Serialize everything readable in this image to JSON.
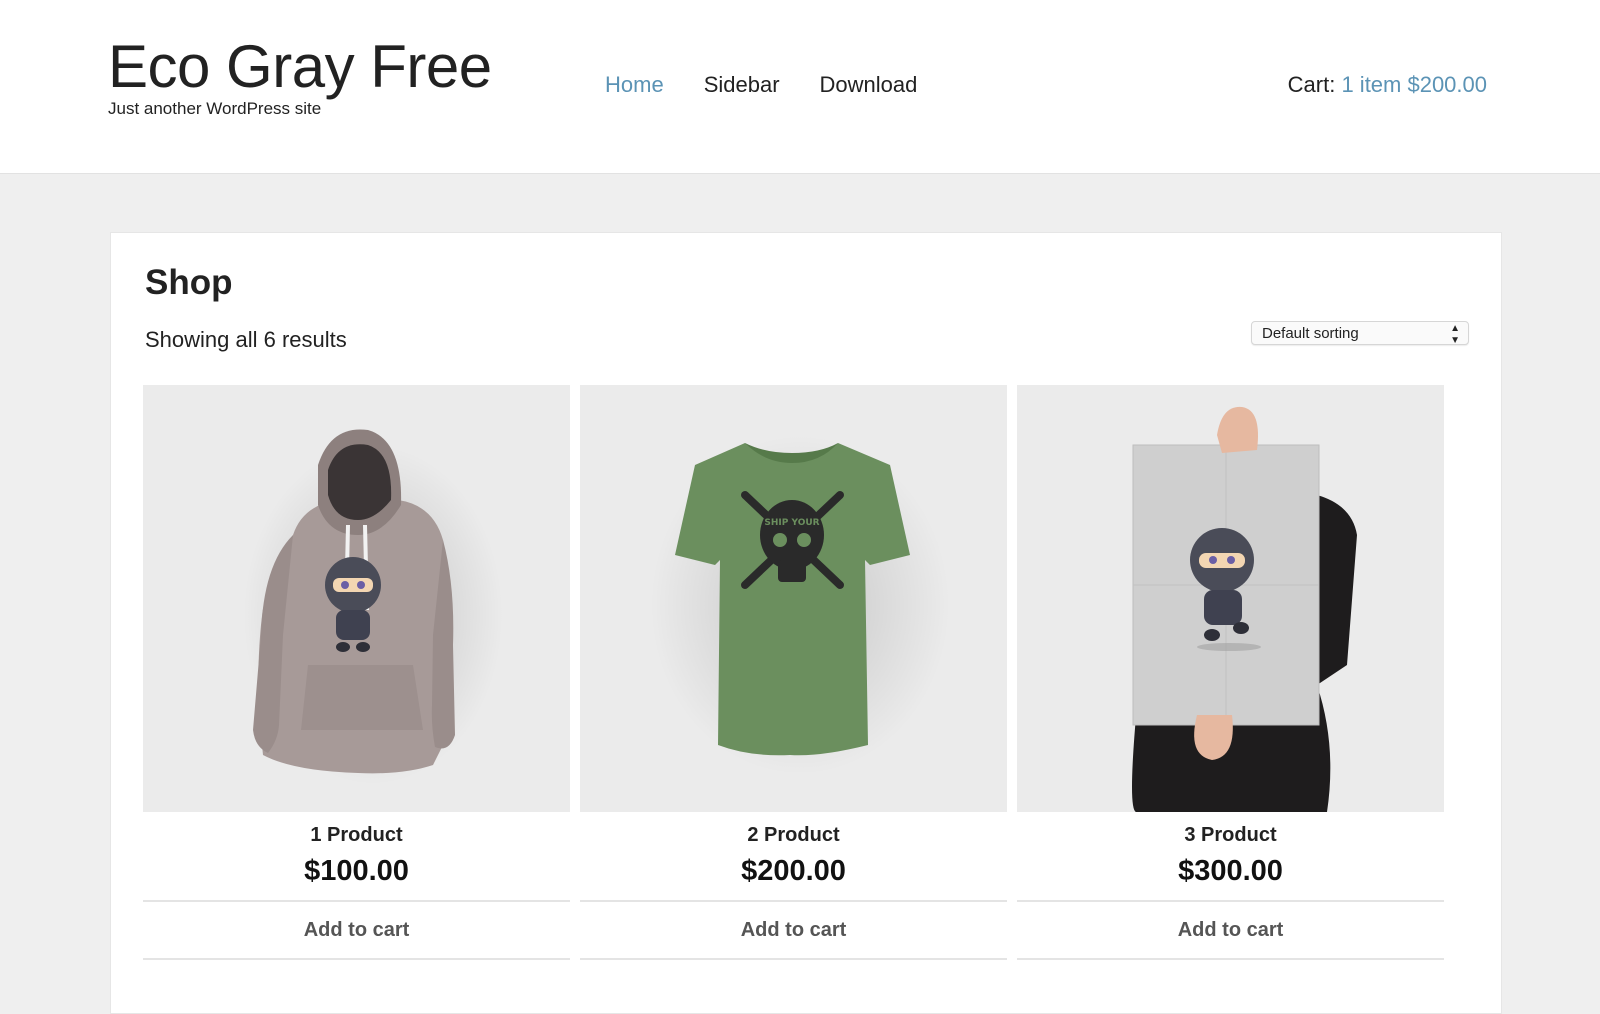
{
  "header": {
    "site_title": "Eco Gray Free",
    "tagline": "Just another WordPress site",
    "nav": [
      {
        "label": "Home",
        "active": true
      },
      {
        "label": "Sidebar",
        "active": false
      },
      {
        "label": "Download",
        "active": false
      }
    ],
    "cart_label": "Cart:",
    "cart_link": "1 item $200.00"
  },
  "main": {
    "title": "Shop",
    "results_text": "Showing all 6 results",
    "sort_selected": "Default sorting",
    "products": [
      {
        "name": "1 Product",
        "price": "$100.00",
        "button": "Add to cart",
        "image": "hoodie-image"
      },
      {
        "name": "2 Product",
        "price": "$200.00",
        "button": "Add to cart",
        "image": "tshirt-image"
      },
      {
        "name": "3 Product",
        "price": "$300.00",
        "button": "Add to cart",
        "image": "poster-image"
      }
    ]
  },
  "colors": {
    "link": "#5b93b5",
    "page_bg": "#efefef",
    "hoodie": "#a79a98",
    "tshirt": "#6b8f5e"
  }
}
